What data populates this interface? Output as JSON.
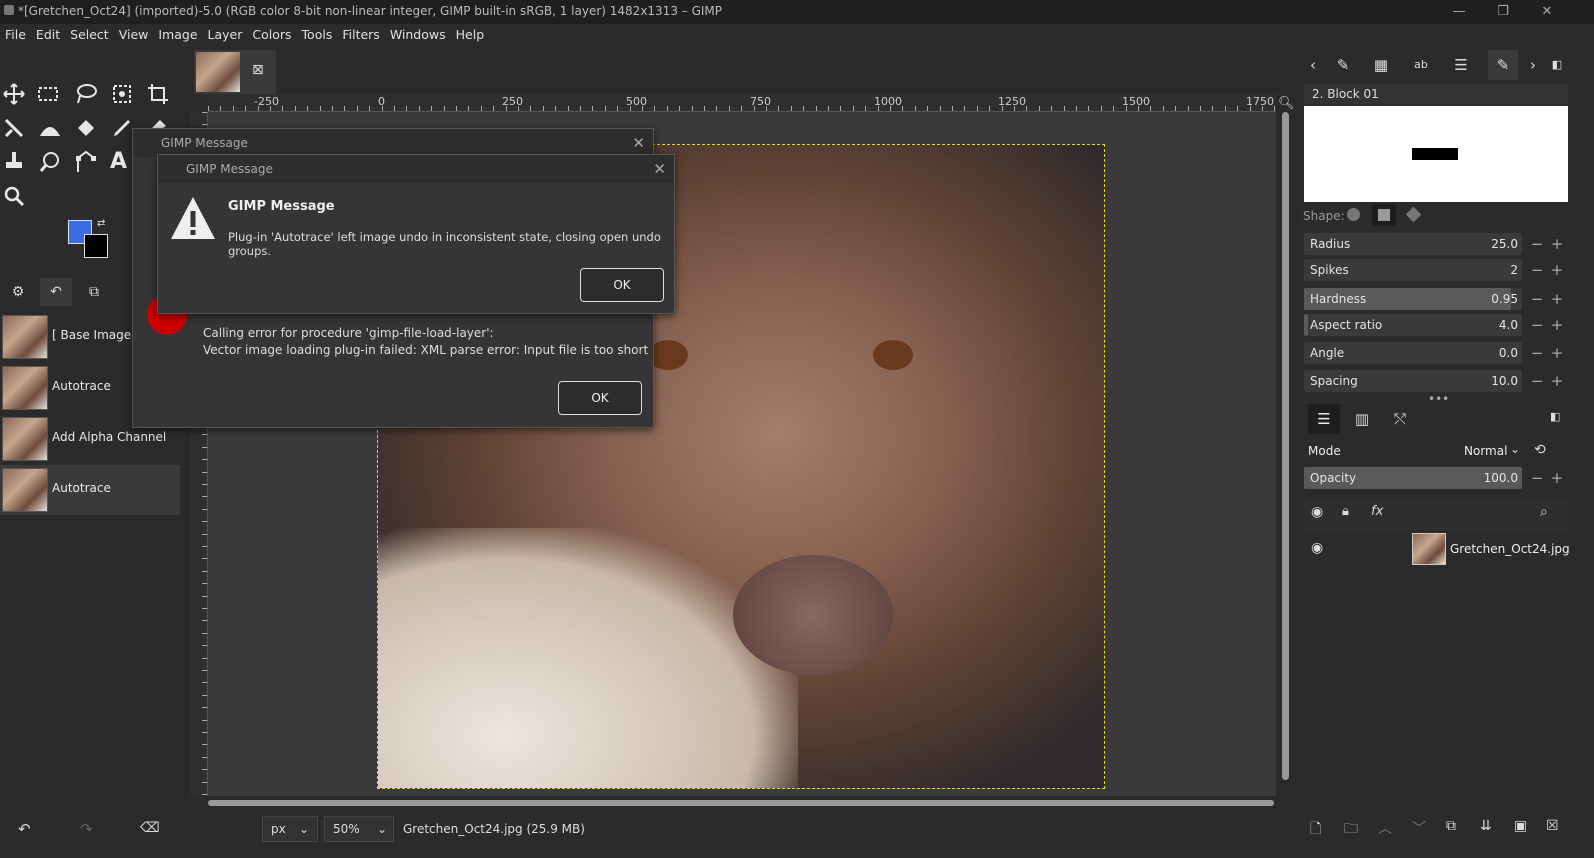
{
  "window": {
    "title": "*[Gretchen_Oct24] (imported)-5.0 (RGB color 8-bit non-linear integer, GIMP built-in sRGB, 1 layer) 1482x1313 – GIMP",
    "minimize": "—",
    "maximize": "❐",
    "close": "✕"
  },
  "menu": [
    "File",
    "Edit",
    "Select",
    "View",
    "Image",
    "Layer",
    "Colors",
    "Tools",
    "Filters",
    "Windows",
    "Help"
  ],
  "history": {
    "items": [
      {
        "label": "[ Base Image ]"
      },
      {
        "label": "Autotrace"
      },
      {
        "label": "Add Alpha Channel"
      },
      {
        "label": "Autotrace"
      }
    ]
  },
  "ruler": {
    "labels": [
      "-250",
      "0",
      "250",
      "500",
      "750",
      "1000",
      "1250",
      "1500",
      "1750"
    ],
    "vlabels": [
      "7",
      "5",
      "0",
      "1",
      "0",
      "0",
      "0",
      "1",
      "2",
      "5"
    ]
  },
  "status": {
    "unit": "px",
    "zoom": "50%",
    "file": "Gretchen_Oct24.jpg (25.9 MB)"
  },
  "brush": {
    "name": "2. Block 01",
    "shape_label": "Shape:"
  },
  "brush_params": [
    {
      "label": "Radius",
      "value": "25.0",
      "level": 0.0
    },
    {
      "label": "Spikes",
      "value": "2",
      "level": 0.0
    },
    {
      "label": "Hardness",
      "value": "0.95",
      "level": 0.95
    },
    {
      "label": "Aspect ratio",
      "value": "4.0",
      "level": 0.02
    },
    {
      "label": "Angle",
      "value": "0.0",
      "level": 0.0
    },
    {
      "label": "Spacing",
      "value": "10.0",
      "level": 0.0
    }
  ],
  "layers": {
    "mode_label": "Mode",
    "mode_value": "Normal",
    "opacity_label": "Opacity",
    "opacity_value": "100.0",
    "opacity_level": 1.0,
    "layer_name": "Gretchen_Oct24.jpg"
  },
  "dialog_back": {
    "title": "GIMP Message",
    "line1": "Calling error for procedure 'gimp-file-load-layer':",
    "line2": "Vector image loading plug-in failed: XML parse error: Input file is too short",
    "ok": "OK"
  },
  "dialog_front": {
    "title": "GIMP Message",
    "heading": "GIMP Message",
    "message": "Plug-in 'Autotrace' left image undo in inconsistent state, closing open undo groups.",
    "ok": "OK"
  },
  "colors": {
    "fg": "#3b6be0",
    "bg": "#000000",
    "accent": "#e0e000"
  }
}
